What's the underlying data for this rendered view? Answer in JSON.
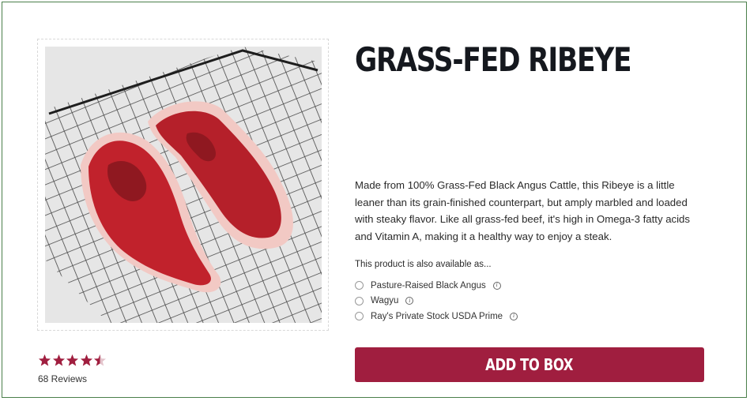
{
  "product": {
    "title": "GRASS-FED RIBEYE",
    "description": "Made from 100% Grass-Fed Black Angus Cattle, this Ribeye is a little leaner than its grain-finished counterpart, but amply marbled and loaded with steaky flavor. Like all grass-fed beef, it's high in Omega-3 fatty acids and Vitamin A, making it a healthy way to enjoy a steak.",
    "image_icon": "steak-photo"
  },
  "availability": {
    "label": "This product is also available as...",
    "options": [
      {
        "label": "Pasture-Raised Black Angus",
        "info_icon": "info-icon"
      },
      {
        "label": "Wagyu",
        "info_icon": "info-icon"
      },
      {
        "label": "Ray's Private Stock USDA Prime",
        "info_icon": "info-icon"
      }
    ]
  },
  "rating": {
    "value": 4.5,
    "max": 5,
    "reviews_label": "68 Reviews"
  },
  "actions": {
    "add_to_box": "ADD TO BOX"
  },
  "colors": {
    "accent": "#a01e3f",
    "star": "#a01e3f",
    "title": "#15181e"
  }
}
